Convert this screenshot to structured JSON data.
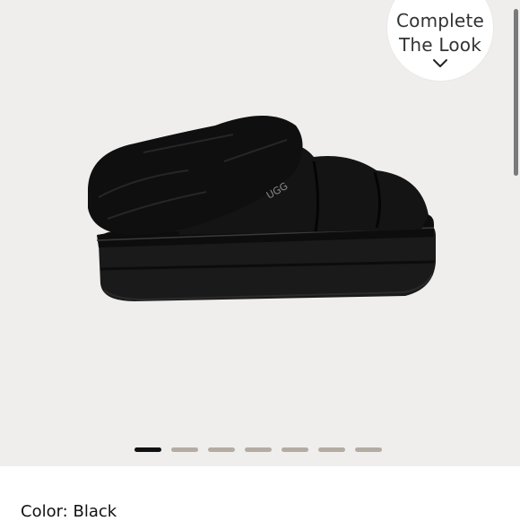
{
  "overlay": {
    "line1": "Complete",
    "line2": "The Look",
    "icon": "chevron-down-icon"
  },
  "product": {
    "logo_text": "UGG",
    "image_icon": "slipper-image"
  },
  "carousel": {
    "slides": [
      {
        "active": true
      },
      {
        "active": false
      },
      {
        "active": false
      },
      {
        "active": false
      },
      {
        "active": false
      },
      {
        "active": false
      },
      {
        "active": false
      }
    ]
  },
  "color": {
    "text": "Color: Black"
  },
  "colors": {
    "background": "#efeeec",
    "dot_active": "#111111",
    "dot_inactive": "#b3aca3"
  }
}
